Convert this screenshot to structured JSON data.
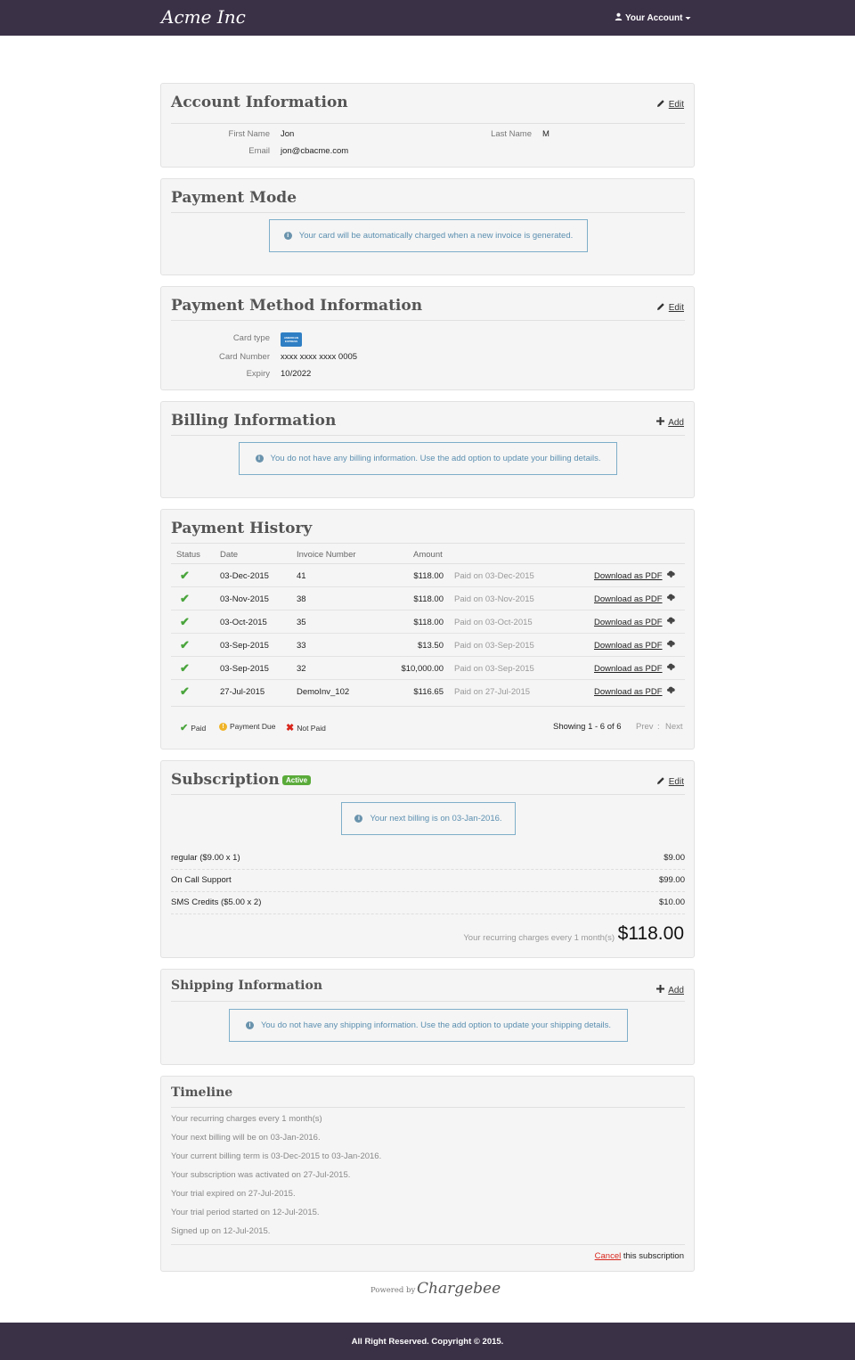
{
  "header": {
    "brand": "Acme Inc",
    "account_label": "Your Account"
  },
  "account": {
    "title": "Account Information",
    "edit_label": "Edit",
    "first_name_label": "First Name",
    "first_name": "Jon",
    "last_name_label": "Last Name",
    "last_name": "M",
    "email_label": "Email",
    "email": "jon@cbacme.com"
  },
  "payment_mode": {
    "title": "Payment Mode",
    "info": "Your card will be automatically charged when a new invoice is generated."
  },
  "payment_method": {
    "title": "Payment Method Information",
    "edit_label": "Edit",
    "card_type_label": "Card type",
    "card_brand": "AMERICAN EXPRESS",
    "card_number_label": "Card Number",
    "card_number": "xxxx xxxx xxxx 0005",
    "expiry_label": "Expiry",
    "expiry": "10/2022"
  },
  "billing": {
    "title": "Billing Information",
    "add_label": "Add",
    "info": "You do not have any billing information. Use the add option to update your billing details."
  },
  "history": {
    "title": "Payment History",
    "headers": {
      "status": "Status",
      "date": "Date",
      "invoice": "Invoice Number",
      "amount": "Amount"
    },
    "rows": [
      {
        "status": "✔",
        "date": "03-Dec-2015",
        "invoice": "41",
        "amount": "$118.00",
        "paid": "Paid on 03-Dec-2015",
        "download": "Download as PDF"
      },
      {
        "status": "✔",
        "date": "03-Nov-2015",
        "invoice": "38",
        "amount": "$118.00",
        "paid": "Paid on 03-Nov-2015",
        "download": "Download as PDF"
      },
      {
        "status": "✔",
        "date": "03-Oct-2015",
        "invoice": "35",
        "amount": "$118.00",
        "paid": "Paid on 03-Oct-2015",
        "download": "Download as PDF"
      },
      {
        "status": "✔",
        "date": "03-Sep-2015",
        "invoice": "33",
        "amount": "$13.50",
        "paid": "Paid on 03-Sep-2015",
        "download": "Download as PDF"
      },
      {
        "status": "✔",
        "date": "03-Sep-2015",
        "invoice": "32",
        "amount": "$10,000.00",
        "paid": "Paid on 03-Sep-2015",
        "download": "Download as PDF"
      },
      {
        "status": "✔",
        "date": "27-Jul-2015",
        "invoice": "DemoInv_102",
        "amount": "$116.65",
        "paid": "Paid on 27-Jul-2015",
        "download": "Download as PDF"
      }
    ],
    "legend": {
      "paid": "Paid",
      "due": "Payment Due",
      "not_paid": "Not Paid"
    },
    "showing": "Showing 1 - 6 of 6",
    "prev": "Prev",
    "sep": ":",
    "next": "Next"
  },
  "subscription": {
    "title": "Subscription",
    "badge": "Active",
    "edit_label": "Edit",
    "info": "Your next billing is on 03-Jan-2016.",
    "lines": [
      {
        "name": "regular ($9.00 x 1)",
        "price": "$9.00"
      },
      {
        "name": "On Call Support",
        "price": "$99.00"
      },
      {
        "name": "SMS Credits ($5.00 x 2)",
        "price": "$10.00"
      }
    ],
    "recurring_label": "Your recurring charges every 1 month(s)",
    "total": "$118.00"
  },
  "shipping": {
    "title": "Shipping Information",
    "add_label": "Add",
    "info": "You do not have any shipping information. Use the add option to update your shipping details."
  },
  "timeline": {
    "title": "Timeline",
    "items": [
      "Your recurring charges every 1 month(s)",
      "Your next billing will be on 03-Jan-2016.",
      "Your current billing term is 03-Dec-2015 to 03-Jan-2016.",
      "Your subscription was activated on 27-Jul-2015.",
      "Your trial expired on 27-Jul-2015.",
      "Your trial period started on 12-Jul-2015.",
      "Signed up on 12-Jul-2015."
    ],
    "cancel_link": "Cancel",
    "cancel_suffix": "this subscription"
  },
  "powered": {
    "label": "Powered by",
    "brand": "Chargebee"
  },
  "footer": {
    "text": "All Right Reserved. Copyright © 2015."
  },
  "colors": {
    "topbar": "#3b3147",
    "success": "#4aa53c",
    "danger": "#d9261c",
    "info": "#5b8fb0"
  }
}
